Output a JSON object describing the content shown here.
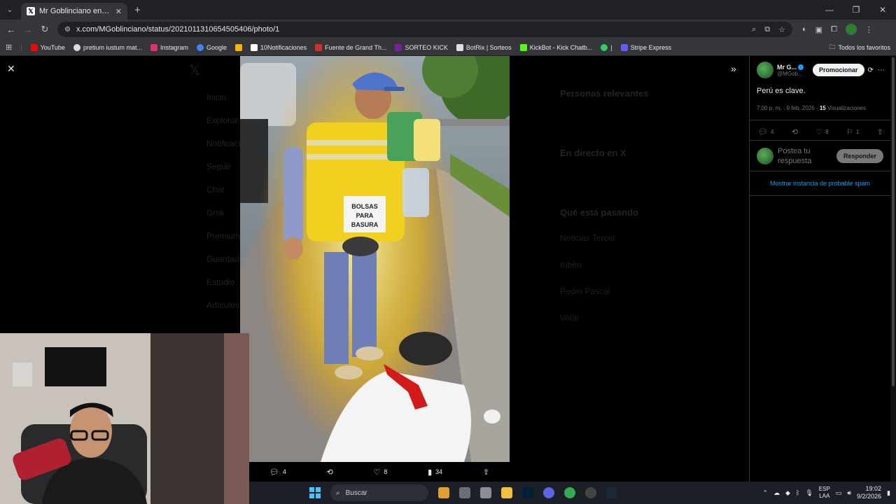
{
  "browser": {
    "tab_title": "Mr Goblinciano en X: \"Perú es c",
    "url": "x.com/MGoblinciano/status/2021011310654505406/photo/1",
    "bookmarks": [
      {
        "label": "YouTube",
        "color": "#ff0000"
      },
      {
        "label": "pretium iustum mat...",
        "color": "#dadce0"
      },
      {
        "label": "Instagram",
        "color": "#e1306c"
      },
      {
        "label": "Google",
        "color": "#4285f4"
      },
      {
        "label": "",
        "color": "#f4b400"
      },
      {
        "label": "10Notificaciones",
        "color": "#000000"
      },
      {
        "label": "Fuente de Grand Th...",
        "color": "#d32f2f"
      },
      {
        "label": "SORTEO KICK",
        "color": "#7b1fa2"
      },
      {
        "label": "BotRix | Sorteos",
        "color": "#e0e0e0"
      },
      {
        "label": "KickBot - Kick Chatb...",
        "color": "#53fc18"
      },
      {
        "label": "|",
        "color": "#25d366"
      },
      {
        "label": "Stripe Express",
        "color": "#635bff"
      }
    ],
    "all_bookmarks": "Todos los favoritos"
  },
  "background_ui": {
    "nav_items": [
      "Inicio",
      "Explorar",
      "Notificaciones",
      "Seguir",
      "Chat",
      "Grok",
      "Premium",
      "Guardados",
      "Estudio",
      "Artículos"
    ],
    "right_headers": [
      "Personas relevantes",
      "En directo en X",
      "Qué está pasando"
    ],
    "right_items": [
      "Noticias Tercer",
      "rubén",
      "Pedro Pascal",
      "Votar"
    ]
  },
  "media_actions": {
    "replies": "4",
    "likes": "8",
    "views": "34"
  },
  "tweet": {
    "author_name": "Mr G...",
    "author_handle": "@MGob...",
    "promote_label": "Promocionar",
    "text": "Perú es clave.",
    "time": "7:00 p. m. · 9 feb. 2026 · ",
    "views_count": "15",
    "views_label": "Visualizaciones",
    "replies": "4",
    "likes": "8",
    "bookmarks": "1",
    "reply_placeholder": "Postea tu respuesta",
    "reply_button": "Responder",
    "spam_link": "Mostrar instancia de probable spam"
  },
  "taskbar": {
    "search": "Buscar",
    "lang_top": "ESP",
    "lang_bottom": "LAA",
    "time": "19:02",
    "date": "9/2/2026"
  }
}
